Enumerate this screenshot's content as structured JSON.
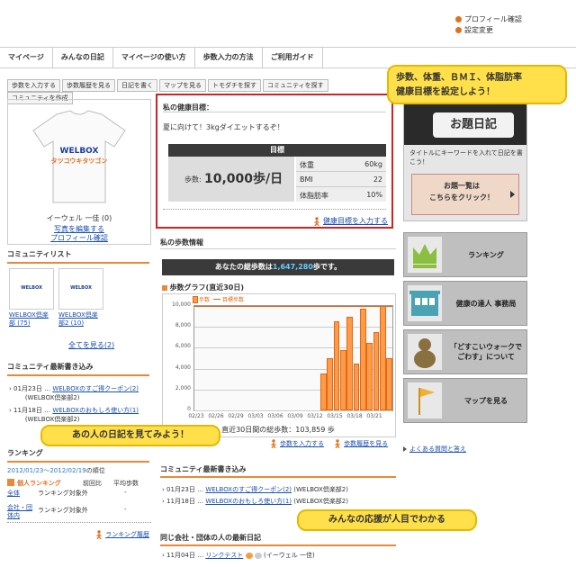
{
  "top_links": [
    "プロフィール確認",
    "設定変更"
  ],
  "nav": [
    "マイページ",
    "みんなの日記",
    "マイページの使い方",
    "歩数入力の方法",
    "ご利用ガイド"
  ],
  "subnav": [
    "歩数を入力する",
    "歩数履歴を見る",
    "日記を書く",
    "マップを見る",
    "トモダチを探す",
    "コミュニティを探す",
    "コミュニティを作成"
  ],
  "profile": {
    "shirt_logo": "WELBOX",
    "shirt_sub": "タツコウキタツゴン",
    "name": "イーウェル 一佳 (0)",
    "links": [
      "写真を編集する",
      "プロフィール確認"
    ]
  },
  "community_list": {
    "title": "コミュニティリスト",
    "items": [
      {
        "shirt": "WELBOX",
        "label": "WELBOX倶楽部 (75)"
      },
      {
        "shirt": "WELBOX",
        "label": "WELBOX倶楽部2 (10)"
      }
    ],
    "more": "全てを見る(2)"
  },
  "community_latest": {
    "title": "コミュニティ最新書き込み",
    "items": [
      {
        "date": "01月23日 …",
        "link": "WELBOXのすご得クーポン(2)",
        "tail": "(WELBOX倶楽部2)"
      },
      {
        "date": "11月18日 …",
        "link": "WELBOXのおもしろ使い方(1)",
        "tail": "(WELBOX倶楽部2)"
      }
    ]
  },
  "ranking": {
    "title": "ランキング",
    "period": "2012/01/23～2012/02/19",
    "period_suffix": "の順位",
    "col_prev": "前回比",
    "col_avg": "平均歩数",
    "personal_label": "個人ランキング",
    "rows": [
      {
        "label": "全体",
        "value": "ランキング対象外",
        "dash": "-"
      },
      {
        "label": "会社・団体内",
        "value": "ランキング対象外",
        "dash": "-"
      }
    ],
    "history": "ランキング履歴"
  },
  "health_goal": {
    "title": "私の健康目標：",
    "text": "夏に向けて！3kgダイエットするぞ！",
    "goal_header": "目標",
    "steps_label": "歩数:",
    "steps_value": "10,000歩/日",
    "rows": [
      {
        "label": "体重",
        "value": "60kg"
      },
      {
        "label": "BMI",
        "value": "22"
      },
      {
        "label": "体脂肪率",
        "value": "10%"
      }
    ],
    "input_link": "健康目標を入力する"
  },
  "steps_info": {
    "title": "私の歩数情報",
    "total_prefix": "あなたの総歩数は",
    "total_value": "1,647,280",
    "total_suffix": "歩です。",
    "graph_title": "歩数グラフ(直近30日)",
    "recent_total": "直近30日間の総歩数：103,859 歩",
    "links": [
      "歩数を入力する",
      "歩数履歴を見る"
    ]
  },
  "chart_data": {
    "type": "bar",
    "legend": [
      "歩数",
      "目標歩数"
    ],
    "ylim": [
      0,
      10000
    ],
    "yticks": [
      "10,000",
      "8,000",
      "6,000",
      "4,000",
      "2,000",
      "0"
    ],
    "x_labels": [
      "02/23",
      "02/26",
      "02/29",
      "03/03",
      "03/06",
      "03/09",
      "03/12",
      "03/15",
      "03/18",
      "03/21"
    ],
    "values": [
      0,
      0,
      0,
      0,
      0,
      0,
      0,
      0,
      0,
      0,
      0,
      0,
      0,
      0,
      0,
      0,
      0,
      0,
      0,
      3500,
      5000,
      8500,
      5800,
      9000,
      4500,
      9700,
      6500,
      7500,
      10000,
      5000
    ],
    "goal": 10000
  },
  "community_latest_center": {
    "title": "コミュニティ最新書き込み",
    "items": [
      {
        "date": "01月23日 …",
        "link": "WELBOXのすご得クーポン(2)",
        "tail": "(WELBOX倶楽部2)"
      },
      {
        "date": "11月18日 …",
        "link": "WELBOXのおもしろ使い方(1)",
        "tail": "(WELBOX倶楽部2)"
      }
    ]
  },
  "company_diary": {
    "title": "同じ会社・団体の人の最新日記",
    "date": "11月04日 …",
    "link": "リンクテスト",
    "tail": "(イーウェル 一佳)"
  },
  "callouts": {
    "top": "歩数、体重、ＢＭＩ、体脂肪率\n健康目標を設定しよう！",
    "middle": "あの人の日記を見てみよう！",
    "bottom": "みんなの応援が人目でわかる"
  },
  "right_panel": {
    "banner_title": "お題日記",
    "banner_text": "タイトルにキーワードを入れて日記を書こう！",
    "banner_button": "お題一覧は\nこちらをクリック！",
    "buttons": [
      "ランキング",
      "健康の達人 事務局",
      "「どすこいウォークで\nごわす」について",
      "マップを見る"
    ],
    "faq": "よくある質問と答え"
  },
  "colors": {
    "accent": "#e8893a",
    "bar": "#ff9a4a",
    "callout": "#ffe04a",
    "goal_border": "#d42020",
    "dark_bar": "#3a3a3a",
    "link": "#1a4fb0"
  }
}
